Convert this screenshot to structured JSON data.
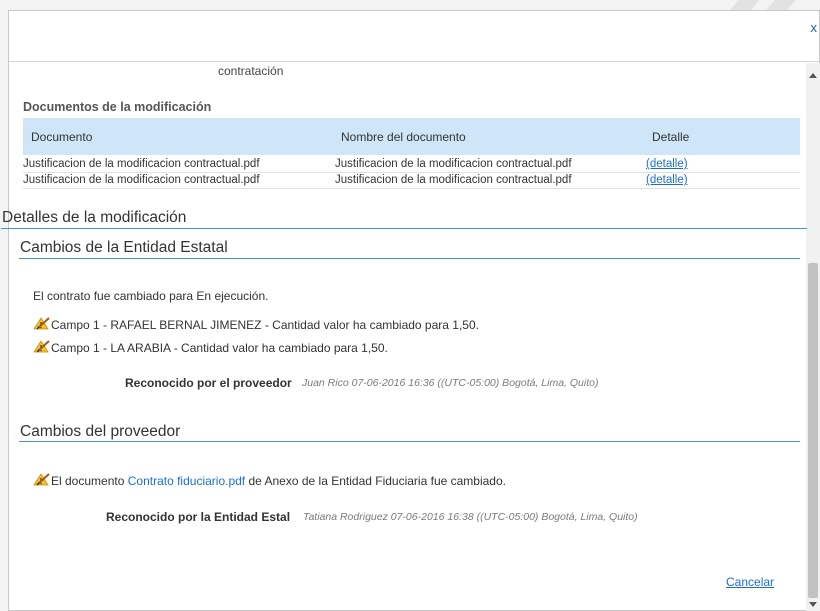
{
  "dialog": {
    "close_label": "x",
    "cancel_label": "Cancelar"
  },
  "previous": {
    "trailing_text": "contratación"
  },
  "documents": {
    "title": "Documentos de la modificación",
    "columns": [
      "Documento",
      "Nombre del documento",
      "Detalle"
    ],
    "rows": [
      {
        "document": "Justificacion de la modificacion contractual.pdf",
        "name": "Justificacion de la modificacion contractual.pdf",
        "detail": "(detalle)"
      },
      {
        "document": "Justificacion de la modificacion contractual.pdf",
        "name": "Justificacion de la modificacion contractual.pdf",
        "detail": "(detalle)"
      }
    ]
  },
  "details": {
    "title": "Detalles de la modificación",
    "entity": {
      "title": "Cambios de la Entidad Estatal",
      "status_text": "El contrato fue cambiado para En ejecución.",
      "changes": [
        "Campo 1 - RAFAEL BERNAL JIMENEZ - Cantidad valor ha cambiado para 1,50.",
        "Campo 1 - LA ARABIA - Cantidad valor ha cambiado para 1,50."
      ],
      "ack_label": "Reconocido por el proveedor",
      "ack_info": "Juan Rico 07-06-2016 16:36 ((UTC-05:00) Bogotá, Lima, Quito)"
    },
    "provider": {
      "title": "Cambios del proveedor",
      "change_prefix": "El documento",
      "change_link": "Contrato fiduciario.pdf",
      "change_suffix": "de Anexo de la Entidad Fiduciaria fue cambiado.",
      "ack_label": "Reconocido por la Entidad Estal",
      "ack_info": "Tatiana Rodriguez 07-06-2016 16:38 ((UTC-05:00) Bogotá, Lima, Quito)"
    }
  },
  "icons": {
    "edit": "pencil-warning-icon"
  },
  "colors": {
    "header_row": "#cfe5f8",
    "link": "#1a6fd1",
    "rule": "#4a90d9"
  }
}
